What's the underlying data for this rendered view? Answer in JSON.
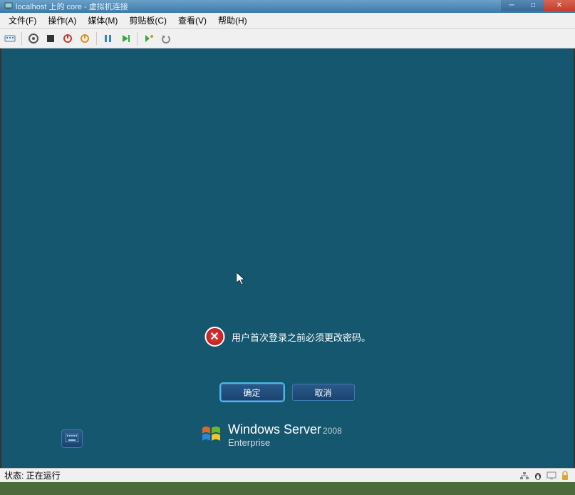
{
  "titlebar": {
    "title": "localhost 上的 core - 虚拟机连接"
  },
  "menu": {
    "file": "文件(F)",
    "action": "操作(A)",
    "media": "媒体(M)",
    "clipboard": "剪贴板(C)",
    "view": "查看(V)",
    "help": "帮助(H)"
  },
  "dialog": {
    "message": "用户首次登录之前必须更改密码。",
    "ok": "确定",
    "cancel": "取消"
  },
  "branding": {
    "product": "Windows Server",
    "year": "2008",
    "edition": "Enterprise"
  },
  "status": {
    "label": "状态: 正在运行"
  }
}
